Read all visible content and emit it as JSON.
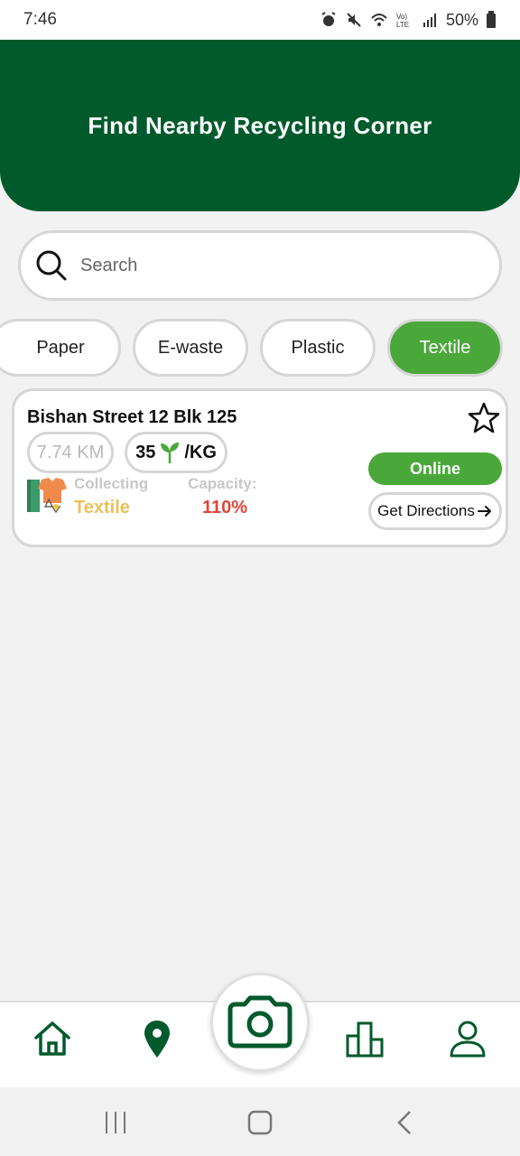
{
  "status_bar": {
    "time": "7:46",
    "battery": "50%",
    "icons": [
      "alarm-icon",
      "mute-icon",
      "wifi-icon",
      "volte-icon",
      "signal-icon",
      "battery-icon"
    ]
  },
  "header": {
    "title": "Find Nearby Recycling Corner"
  },
  "search": {
    "placeholder": "Search"
  },
  "filters": {
    "items": [
      {
        "label": "Paper",
        "active": false
      },
      {
        "label": "E-waste",
        "active": false
      },
      {
        "label": "Plastic",
        "active": false
      },
      {
        "label": "Textile",
        "active": true
      }
    ]
  },
  "location_card": {
    "title": "Bishan Street 12 Blk 125",
    "distance": "7.74 KM",
    "points_value": "35",
    "points_unit": "/KG",
    "collecting_label": "Collecting",
    "collecting_value": "Textile",
    "capacity_label": "Capacity:",
    "capacity_value": "110%",
    "status": "Online",
    "directions_label": "Get Directions"
  },
  "bottom_nav": {
    "items": [
      "home-icon",
      "location-pin-icon",
      "camera-icon",
      "leaderboard-icon",
      "profile-icon"
    ]
  },
  "colors": {
    "primary": "#005a2b",
    "accent": "#4aa83a",
    "collecting": "#e9c15a",
    "capacity": "#e0473a"
  }
}
